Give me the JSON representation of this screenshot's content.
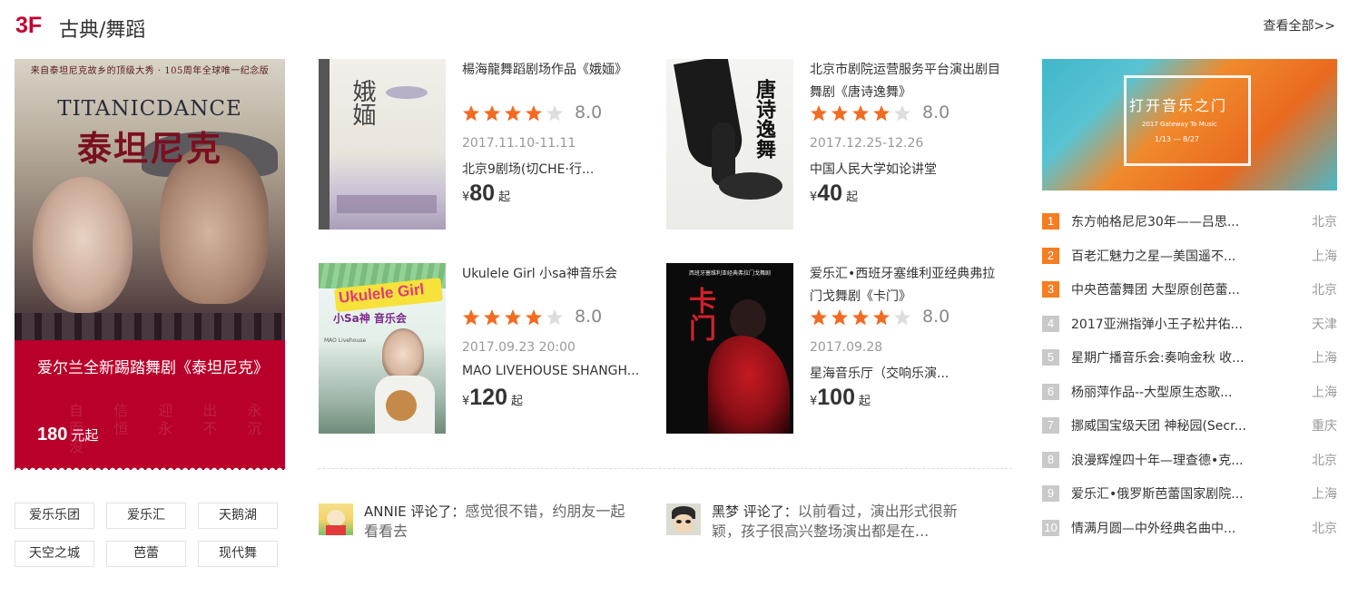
{
  "header": {
    "floor": "3F",
    "title": "古典/舞蹈",
    "view_all": "查看全部>>"
  },
  "feature": {
    "poster_tagline": "来自泰坦尼克故乡的顶级大秀 · 105周年全球唯一纪念版",
    "poster_logo_en": "TITANICDANCE",
    "poster_logo_cn": "泰坦尼克",
    "title": "爱尔兰全新踢踏舞剧《泰坦尼克》",
    "price": "180",
    "price_unit": "元起",
    "bg_chars": "自  信  迎  出  永  而  恒  永  不  沉  没"
  },
  "tags": [
    "爱乐乐团",
    "爱乐汇",
    "天鹅湖",
    "天空之城",
    "芭蕾",
    "现代舞"
  ],
  "shows": [
    {
      "name": "楊海龍舞蹈剧场作品《娥媔》",
      "rating": 4,
      "score": "8.0",
      "date": "2017.11.10-11.11",
      "venue": "北京9剧场(切CHE·行...",
      "currency": "¥",
      "price": "80",
      "suffix": "起",
      "poster_text": "娥媔"
    },
    {
      "name": "北京市剧院运营服务平台演出剧目 舞剧《唐诗逸舞》",
      "rating": 4,
      "score": "8.0",
      "date": "2017.12.25-12.26",
      "venue": "中国人民大学如论讲堂",
      "currency": "¥",
      "price": "40",
      "suffix": "起",
      "poster_text": "唐诗逸舞"
    },
    {
      "name": "Ukulele Girl 小sa神音乐会",
      "rating": 4,
      "score": "8.0",
      "date": "2017.09.23 20:00",
      "venue": "MAO LIVEHOUSE SHANGH...",
      "currency": "¥",
      "price": "120",
      "suffix": "起",
      "poster_text": "Ukulele Girl",
      "poster_sub": "小Sa神 音乐会",
      "poster_small": "MAO Livehouse"
    },
    {
      "name": "爱乐汇•西班牙塞维利亚经典弗拉门戈舞剧《卡门》",
      "rating": 4,
      "score": "8.0",
      "date": "2017.09.28",
      "venue": "星海音乐厅（交响乐演...",
      "currency": "¥",
      "price": "100",
      "suffix": "起",
      "poster_text": "卡门",
      "poster_head": "西班牙塞维利亚经典弗拉门戈舞剧"
    }
  ],
  "comments": [
    {
      "user": "ANNIE",
      "verb": " 评论了：",
      "text": "感觉很不错，约朋友一起看看去"
    },
    {
      "user": "黑梦",
      "verb": " 评论了：",
      "text": "以前看过，演出形式很新颖，孩子很高兴整场演出都是在..."
    }
  ],
  "promo": {
    "title": "打开音乐之门",
    "subtitle": "2017 Gateway To Music",
    "date": "1/13 — 8/27"
  },
  "ranking": [
    {
      "no": "1",
      "title": "东方帕格尼尼30年——吕思...",
      "city": "北京"
    },
    {
      "no": "2",
      "title": "百老汇魅力之星—美国遥不...",
      "city": "上海"
    },
    {
      "no": "3",
      "title": "中央芭蕾舞团 大型原创芭蕾...",
      "city": "北京"
    },
    {
      "no": "4",
      "title": "2017亚洲指弹小王子松井佑...",
      "city": "天津"
    },
    {
      "no": "5",
      "title": "星期广播音乐会:奏响金秋 收...",
      "city": "上海"
    },
    {
      "no": "6",
      "title": "杨丽萍作品--大型原生态歌...",
      "city": "上海"
    },
    {
      "no": "7",
      "title": "挪威国宝级天团 神秘园(Secr...",
      "city": "重庆"
    },
    {
      "no": "8",
      "title": "浪漫辉煌四十年—理查德•克...",
      "city": "北京"
    },
    {
      "no": "9",
      "title": "爱乐汇•俄罗斯芭蕾国家剧院...",
      "city": "上海"
    },
    {
      "no": "10",
      "title": "情满月圆—中外经典名曲中...",
      "city": "北京"
    }
  ],
  "colors": {
    "brand": "#c3002f",
    "star": "#f26b22",
    "rank_top": "#f57e22",
    "rank_other": "#c9c9c9"
  }
}
